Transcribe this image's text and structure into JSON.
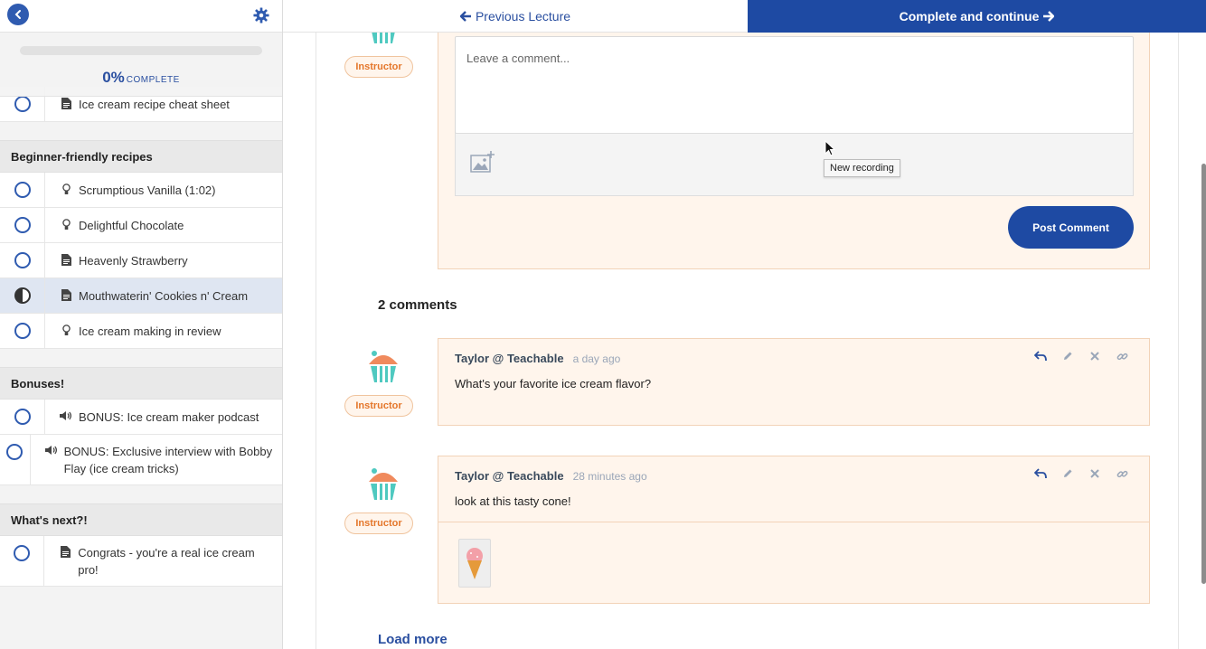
{
  "progress": {
    "percent_text": "0%",
    "complete_label": "COMPLETE",
    "value": 0
  },
  "nav": {
    "previous_label": "Previous Lecture",
    "complete_label": "Complete and continue"
  },
  "sidebar": {
    "top_items": [
      {
        "label": "Ice cream recipe cheat sheet",
        "icon": "document-icon",
        "status": "not-started"
      }
    ],
    "sections": [
      {
        "title": "Beginner-friendly recipes",
        "items": [
          {
            "label": "Scrumptious Vanilla (1:02)",
            "icon": "lightbulb-icon",
            "status": "not-started"
          },
          {
            "label": "Delightful Chocolate",
            "icon": "lightbulb-icon",
            "status": "not-started"
          },
          {
            "label": "Heavenly Strawberry",
            "icon": "document-icon",
            "status": "not-started"
          },
          {
            "label": "Mouthwaterin' Cookies n' Cream",
            "icon": "document-icon",
            "status": "in-progress"
          },
          {
            "label": "Ice cream making in review",
            "icon": "lightbulb-icon",
            "status": "not-started"
          }
        ]
      },
      {
        "title": "Bonuses!",
        "items": [
          {
            "label": "BONUS: Ice cream maker podcast",
            "icon": "audio-icon",
            "status": "not-started"
          },
          {
            "label": "BONUS: Exclusive interview with Bobby Flay (ice cream tricks)",
            "icon": "audio-icon",
            "status": "not-started"
          }
        ]
      },
      {
        "title": "What's next?!",
        "items": [
          {
            "label": "Congrats - you're a real ice cream pro!",
            "icon": "document-icon",
            "status": "not-started"
          }
        ]
      }
    ]
  },
  "compose": {
    "placeholder": "Leave a comment...",
    "post_label": "Post Comment",
    "tooltip": "New recording",
    "badge": "Instructor"
  },
  "comments": {
    "count_title": "2 comments",
    "items": [
      {
        "author": "Taylor @ Teachable",
        "time": "a day ago",
        "body": "What's your favorite ice cream flavor?",
        "badge": "Instructor"
      },
      {
        "author": "Taylor @ Teachable",
        "time": "28 minutes ago",
        "body": "look at this tasty cone!",
        "badge": "Instructor"
      }
    ],
    "load_more": "Load more"
  },
  "colors": {
    "primary": "#1e4aa3",
    "instructor": "#e4762a",
    "comment_bg": "#fff5ec"
  }
}
